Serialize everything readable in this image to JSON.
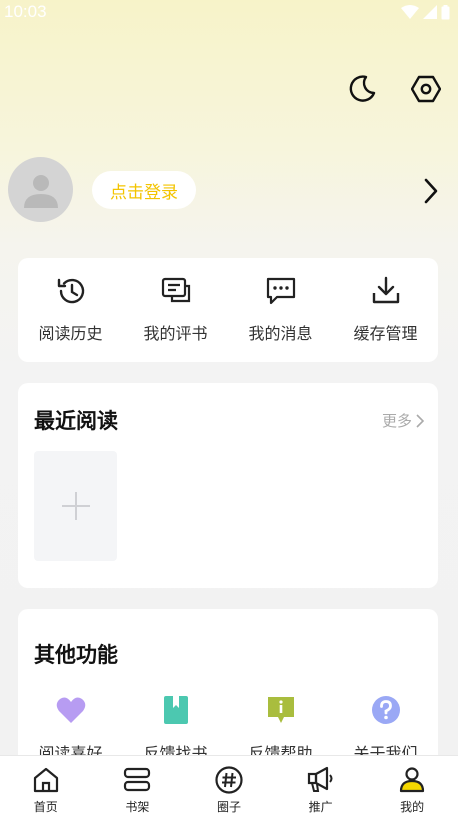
{
  "status_bar": {
    "time": "10:03"
  },
  "header": {
    "theme_icon": "moon-icon",
    "settings_icon": "hexagon-settings-icon"
  },
  "profile": {
    "avatar_icon": "default-avatar-icon",
    "login_label": "点击登录",
    "login_color": "#f3c400"
  },
  "quick_actions": [
    {
      "icon": "history-icon",
      "label": "阅读历史"
    },
    {
      "icon": "comment-book-icon",
      "label": "我的评书"
    },
    {
      "icon": "message-icon",
      "label": "我的消息"
    },
    {
      "icon": "download-icon",
      "label": "缓存管理"
    }
  ],
  "recent": {
    "title": "最近阅读",
    "more_label": "更多"
  },
  "other": {
    "title": "其他功能",
    "items": [
      {
        "icon": "heart-icon",
        "label": "阅读喜好",
        "color": "#b79cf2"
      },
      {
        "icon": "bookmark-icon",
        "label": "反馈找书",
        "color": "#4cc8b0"
      },
      {
        "icon": "info-bubble-icon",
        "label": "反馈帮助",
        "color": "#a9bd3e"
      },
      {
        "icon": "question-icon",
        "label": "关于我们",
        "color": "#9aa8f5"
      }
    ]
  },
  "bottom_nav": [
    {
      "icon": "home-icon",
      "label": "首页"
    },
    {
      "icon": "bookshelf-icon",
      "label": "书架"
    },
    {
      "icon": "hashtag-icon",
      "label": "圈子"
    },
    {
      "icon": "megaphone-icon",
      "label": "推广"
    },
    {
      "icon": "person-icon",
      "label": "我的",
      "active": true
    }
  ],
  "colors": {
    "accent": "#f5d800",
    "page_bg": "#f2f2f2"
  }
}
